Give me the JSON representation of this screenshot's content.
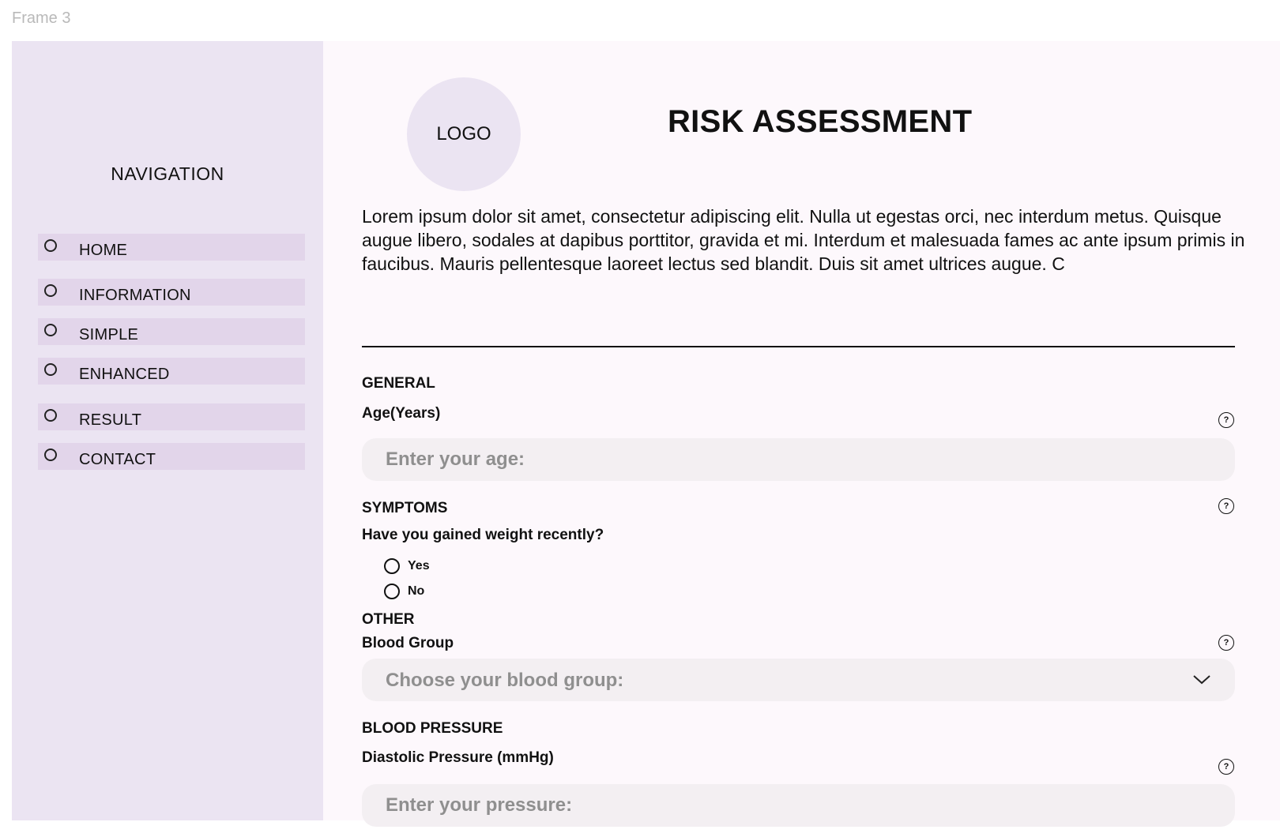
{
  "frame_label": "Frame 3",
  "sidebar": {
    "title": "NAVIGATION",
    "items": [
      {
        "label": "HOME"
      },
      {
        "label": "INFORMATION"
      },
      {
        "label": "SIMPLE"
      },
      {
        "label": "ENHANCED"
      },
      {
        "label": "RESULT"
      },
      {
        "label": "CONTACT"
      }
    ]
  },
  "header": {
    "logo": "LOGO",
    "title": "RISK ASSESSMENT",
    "intro": "Lorem ipsum dolor sit amet, consectetur adipiscing elit. Nulla ut egestas orci, nec interdum metus. Quisque augue libero, sodales at dapibus porttitor, gravida et mi. Interdum et malesuada fames ac ante ipsum primis in faucibus. Mauris pellentesque laoreet lectus sed blandit. Duis sit amet ultrices augue. C"
  },
  "form": {
    "general": {
      "title": "GENERAL",
      "age_label": "Age(Years)",
      "age_placeholder": "Enter your age:",
      "age_value": ""
    },
    "symptoms": {
      "title": "SYMPTOMS",
      "question": "Have you gained weight recently?",
      "options": [
        "Yes",
        "No"
      ],
      "selected": null
    },
    "other": {
      "title": "OTHER",
      "blood_group_label": "Blood Group",
      "blood_group_placeholder": "Choose your blood group:"
    },
    "blood_pressure": {
      "title": "BLOOD PRESSURE",
      "diastolic_label": "Diastolic Pressure (mmHg)",
      "diastolic_placeholder": "Enter your pressure:",
      "diastolic_value": ""
    },
    "help_glyph": "?"
  },
  "colors": {
    "sidebar_bg": "#ebe4f2",
    "nav_item_bg": "#e2d5ea",
    "main_bg": "#fdf8fc",
    "input_bg": "#f3eff2",
    "placeholder": "#8f8f8f"
  },
  "icons": {
    "nav_item": "radio-circle-icon",
    "help": "question-circle-icon",
    "select": "chevron-down-icon"
  }
}
